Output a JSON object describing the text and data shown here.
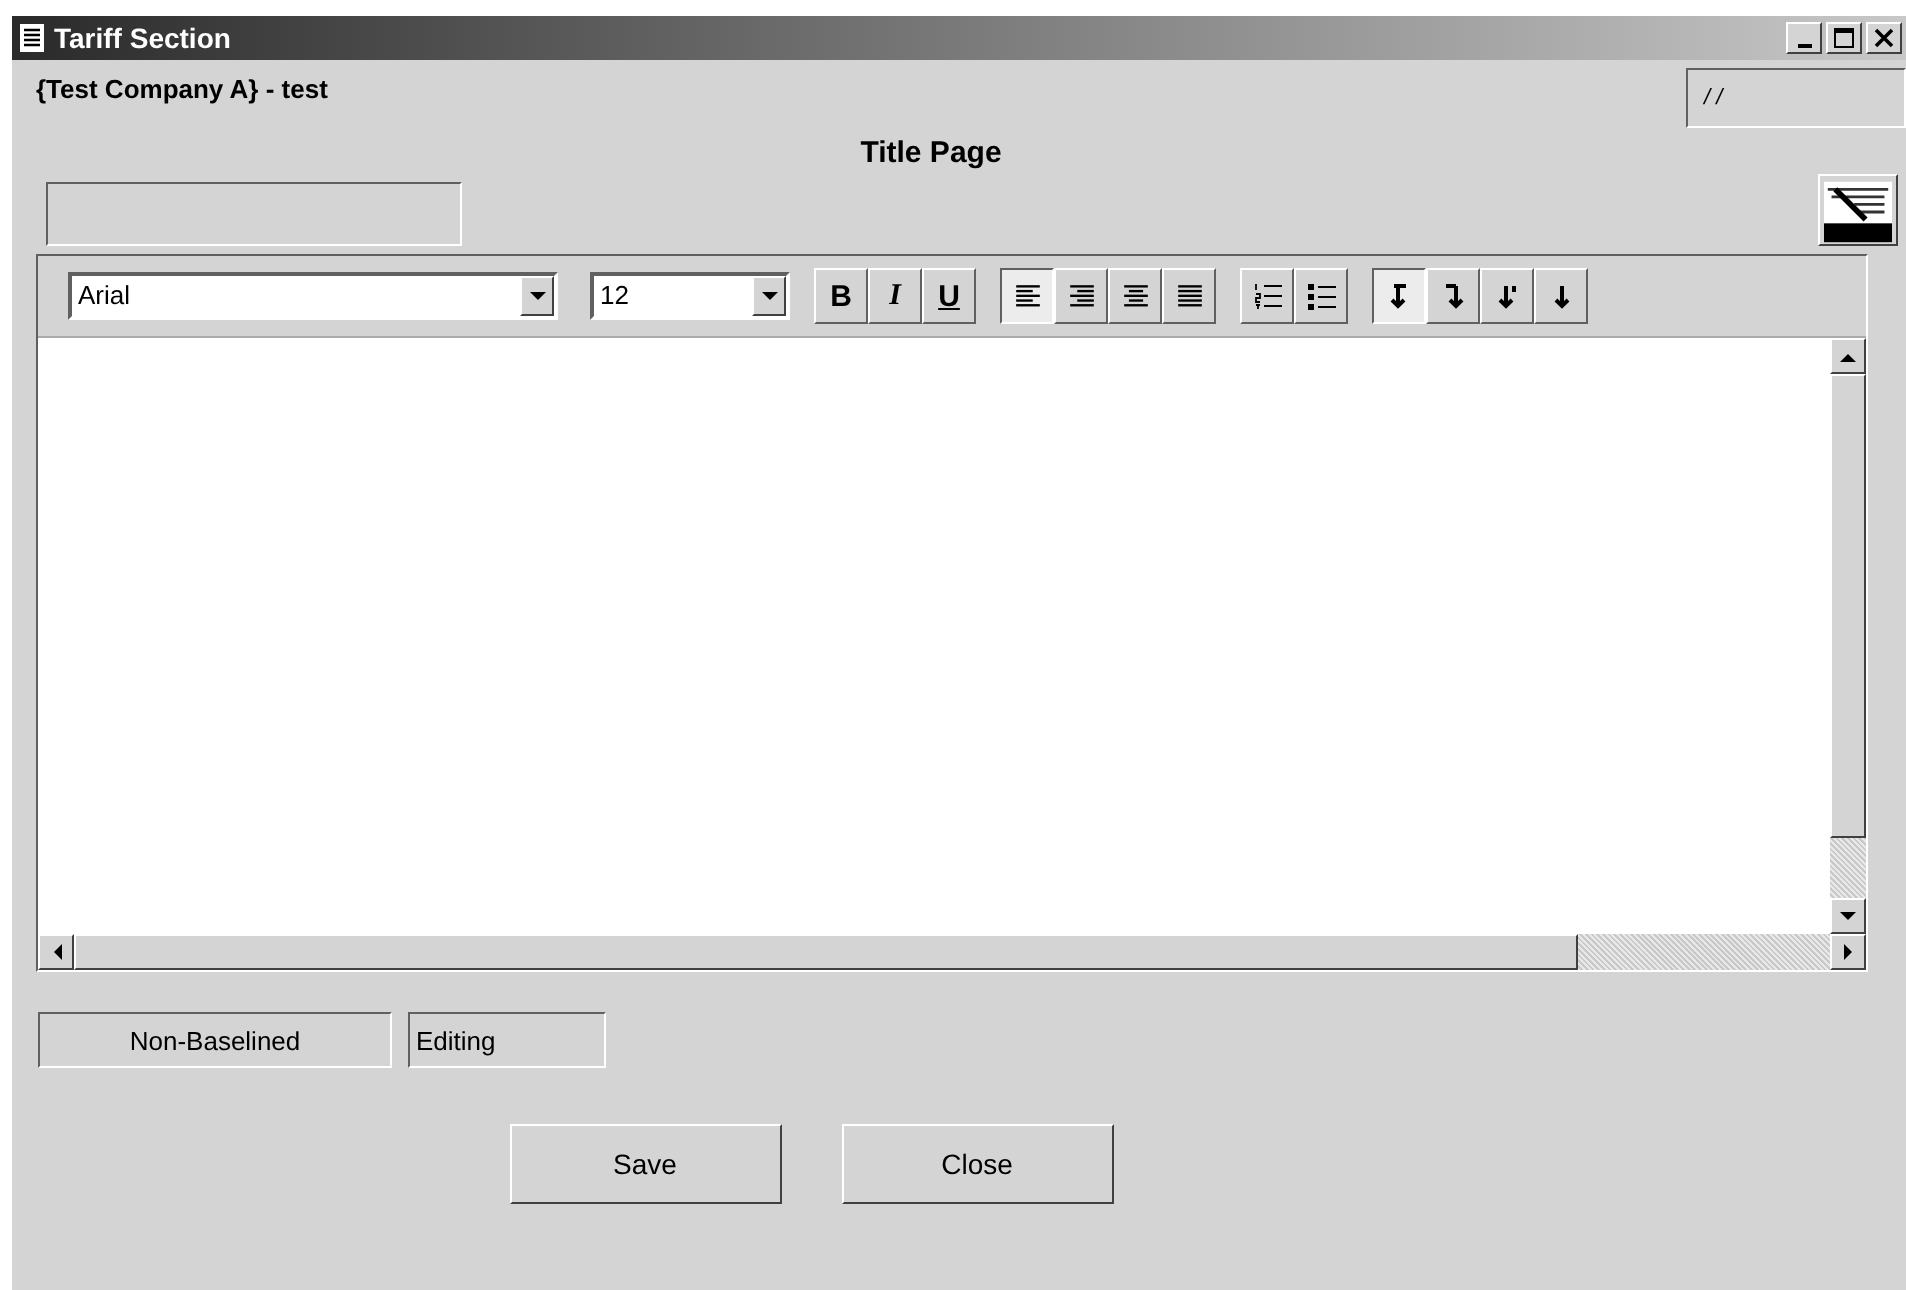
{
  "window": {
    "title": "Tariff Section"
  },
  "company": "{Test Company A} - test",
  "date_field": {
    "value": "/ /"
  },
  "heading": "Title Page",
  "editor": {
    "font": "Arial",
    "size": "12",
    "style_buttons": [
      {
        "label": "B",
        "kind": "bold"
      },
      {
        "label": "I",
        "kind": "italic"
      },
      {
        "label": "U",
        "kind": "underline"
      }
    ],
    "align_buttons": [
      {
        "kind": "left",
        "selected": true
      },
      {
        "kind": "right",
        "selected": false
      },
      {
        "kind": "center",
        "selected": false
      },
      {
        "kind": "justify",
        "selected": false
      }
    ],
    "list_buttons": [
      {
        "kind": "numbered"
      },
      {
        "kind": "bulleted"
      }
    ],
    "break_buttons": [
      {
        "kind": "a",
        "selected": true
      },
      {
        "kind": "b",
        "selected": false
      },
      {
        "kind": "c",
        "selected": false
      },
      {
        "kind": "d",
        "selected": false
      }
    ]
  },
  "status": [
    "Non-Baselined",
    "Editing"
  ],
  "buttons": [
    "Save",
    "Close"
  ]
}
